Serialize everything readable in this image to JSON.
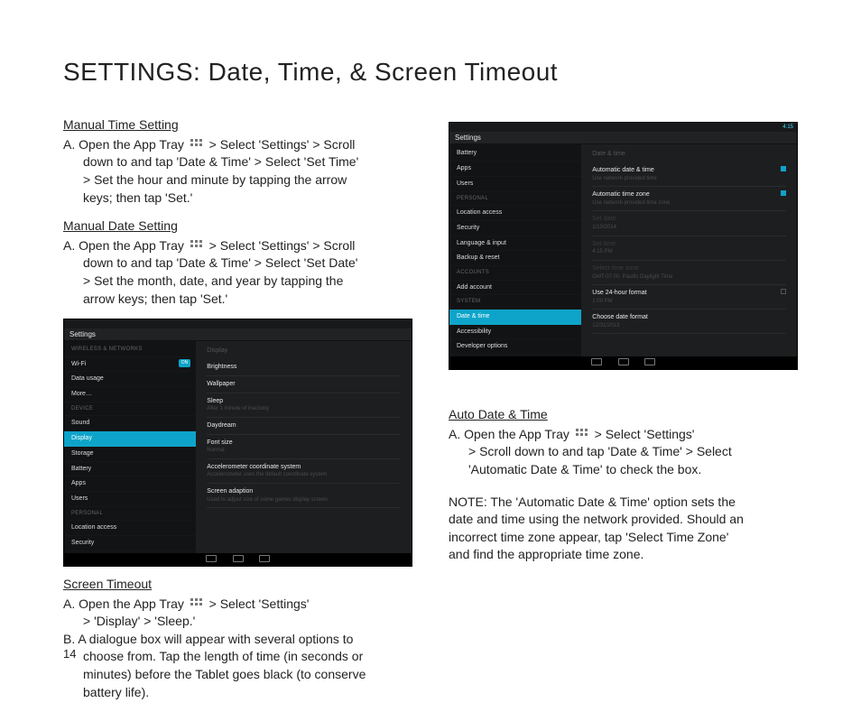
{
  "page_title": "SETTINGS: Date, Time, & Screen Timeout",
  "page_number": "14",
  "manual_time": {
    "heading": "Manual Time Setting",
    "line_a_pre": "A. Open the App Tray ",
    "line_a_post": " > Select 'Settings' > Scroll",
    "line_b": "down to and tap 'Date & Time' > Select 'Set Time'",
    "line_c": "> Set the hour and minute by tapping the arrow",
    "line_d": "keys; then tap 'Set.'"
  },
  "manual_date": {
    "heading": "Manual Date Setting",
    "line_a_pre": "A. Open the App Tray ",
    "line_a_post": " > Select 'Settings' > Scroll",
    "line_b": "down to and tap 'Date & Time' > Select 'Set Date'",
    "line_c": "> Set the month, date, and year by tapping the",
    "line_d": "arrow keys; then tap 'Set.'"
  },
  "screen_timeout": {
    "heading": "Screen Timeout",
    "a_pre": "A. Open the App Tray ",
    "a_post": " > Select 'Settings'",
    "a2": "> 'Display' > 'Sleep.'",
    "b1": "B. A dialogue box will appear with several options to",
    "b2": "choose from. Tap the length of time (in seconds or",
    "b3": "minutes) before the Tablet goes black (to conserve",
    "b4": "battery life)."
  },
  "auto_dt": {
    "heading": "Auto Date & Time",
    "a_pre": "A. Open the App Tray ",
    "a_post": " > Select 'Settings'",
    "a2": "> Scroll down to and tap 'Date & Time' > Select",
    "a3": "'Automatic Date & Time' to check the box."
  },
  "note": {
    "l1": "NOTE: The 'Automatic Date & Time' option sets the",
    "l2": "date and time using the network provided. Should an",
    "l3": "incorrect time zone appear, tap 'Select Time Zone'",
    "l4": "and find the appropriate time zone."
  },
  "ss1": {
    "header": "Settings",
    "nav_cat1": "WIRELESS & NETWORKS",
    "wifi": "Wi-Fi",
    "wifi_on": "ON",
    "data": "Data usage",
    "more": "More…",
    "nav_cat2": "DEVICE",
    "sound": "Sound",
    "display": "Display",
    "storage": "Storage",
    "battery": "Battery",
    "apps": "Apps",
    "users": "Users",
    "nav_cat3": "PERSONAL",
    "location": "Location access",
    "security": "Security",
    "c_head": "Display",
    "c_brightness": "Brightness",
    "c_wallpaper": "Wallpaper",
    "c_sleep": "Sleep",
    "c_sleep_sub": "After 1 minute of inactivity",
    "c_daydream": "Daydream",
    "c_font": "Font size",
    "c_font_sub": "Normal",
    "c_accel": "Accelerometer coordinate system",
    "c_accel_sub": "Accelerometer uses the default coordinate system",
    "c_screen": "Screen adaption",
    "c_screen_sub": "Used to adjust size of some games display screen"
  },
  "ss2": {
    "time": "4:15",
    "header": "Settings",
    "battery": "Battery",
    "apps": "Apps",
    "users": "Users",
    "nav_cat3": "PERSONAL",
    "location": "Location access",
    "security": "Security",
    "language": "Language & input",
    "backup": "Backup & reset",
    "nav_cat4": "ACCOUNTS",
    "addacct": "Add account",
    "nav_cat5": "SYSTEM",
    "datetime": "Date & time",
    "accessibility": "Accessibility",
    "developer": "Developer options",
    "c_head": "Date & time",
    "c_auto_dt": "Automatic date & time",
    "c_auto_dt_sub": "Use network-provided time",
    "c_auto_tz": "Automatic time zone",
    "c_auto_tz_sub": "Use network-provided time zone",
    "c_setdate": "Set date",
    "c_setdate_sub": "1/10/2014",
    "c_settime": "Set time",
    "c_settime_sub": "4:15 PM",
    "c_seltz": "Select time zone",
    "c_seltz_sub": "GMT-07:00, Pacific Daylight Time",
    "c_24h": "Use 24-hour format",
    "c_24h_sub": "1:00 PM",
    "c_datefmt": "Choose date format",
    "c_datefmt_sub": "12/31/2013"
  }
}
